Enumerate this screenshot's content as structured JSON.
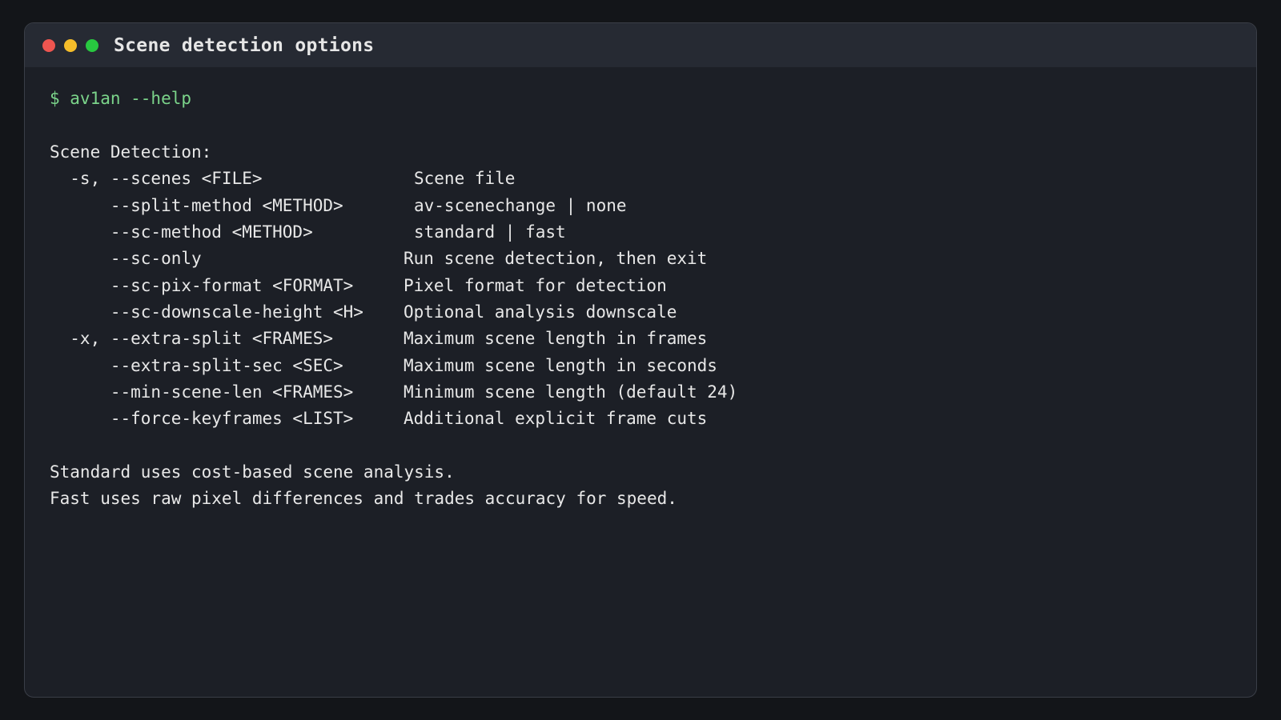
{
  "window": {
    "title": "Scene detection options",
    "controls": {
      "close_color": "#ee5550",
      "minimize_color": "#f5bd2a",
      "maximize_color": "#28c840"
    }
  },
  "terminal": {
    "prompt": "$ av1an --help",
    "section_header": "Scene Detection:",
    "options": [
      {
        "flag": "  -s, --scenes <FILE>",
        "description": "Scene file"
      },
      {
        "flag": "      --split-method <METHOD>",
        "description": "av-scenechange | none"
      },
      {
        "flag": "      --sc-method <METHOD>",
        "description": "standard | fast"
      },
      {
        "flag": "      --sc-only",
        "description": "Run scene detection, then exit"
      },
      {
        "flag": "      --sc-pix-format <FORMAT>",
        "description": "Pixel format for detection"
      },
      {
        "flag": "      --sc-downscale-height <H>",
        "description": "Optional analysis downscale"
      },
      {
        "flag": "  -x, --extra-split <FRAMES>",
        "description": "Maximum scene length in frames"
      },
      {
        "flag": "      --extra-split-sec <SEC>",
        "description": "Maximum scene length in seconds"
      },
      {
        "flag": "      --min-scene-len <FRAMES>",
        "description": "Minimum scene length (default 24)"
      },
      {
        "flag": "      --force-keyframes <LIST>",
        "description": "Additional explicit frame cuts"
      }
    ],
    "notes": [
      "Standard uses cost-based scene analysis.",
      "Fast uses raw pixel differences and trades accuracy for speed."
    ]
  }
}
